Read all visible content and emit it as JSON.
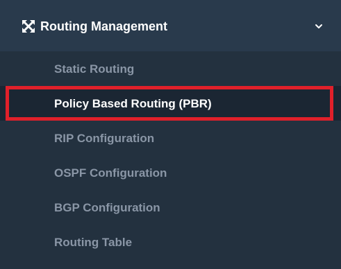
{
  "menu": {
    "title": "Routing Management",
    "icon": "crossed-arrows-icon",
    "expand_icon": "chevron-down-icon",
    "items": [
      {
        "label": "Static Routing",
        "active": false
      },
      {
        "label": "Policy Based Routing (PBR)",
        "active": true
      },
      {
        "label": "RIP Configuration",
        "active": false
      },
      {
        "label": "OSPF Configuration",
        "active": false
      },
      {
        "label": "BGP Configuration",
        "active": false
      },
      {
        "label": "Routing Table",
        "active": false
      }
    ]
  },
  "colors": {
    "header_bg": "#293a4c",
    "submenu_bg": "#23313f",
    "active_bg": "#1b2633",
    "highlight_border": "#e0202a",
    "inactive_text": "#8a96a6",
    "active_text": "#ffffff"
  }
}
